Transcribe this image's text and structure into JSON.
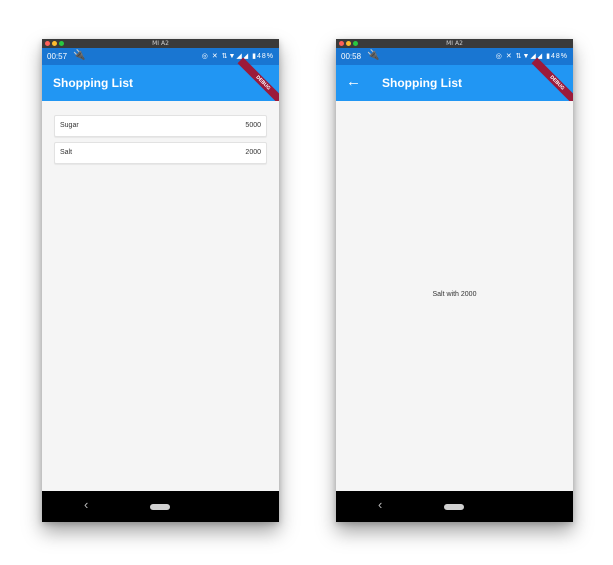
{
  "left": {
    "window_title": "MI A2",
    "status": {
      "time": "00:57",
      "icons_text": "◎ ✕ ⇅▼◢◢ ▮48%"
    },
    "appbar": {
      "title": "Shopping List"
    },
    "debug_banner": "DEBUG",
    "items": [
      {
        "name": "Sugar",
        "qty": "5000"
      },
      {
        "name": "Salt",
        "qty": "2000"
      }
    ]
  },
  "right": {
    "window_title": "MI A2",
    "status": {
      "time": "00:58",
      "icons_text": "◎ ✕ ⇅▼◢◢ ▮48%"
    },
    "appbar": {
      "title": "Shopping List"
    },
    "debug_banner": "DEBUG",
    "detail_text": "Salt with 2000"
  },
  "colors": {
    "appbar": "#2196f3",
    "statusbar": "#1976d2",
    "debug": "#9c1a3a",
    "background": "#f5f5f5"
  }
}
